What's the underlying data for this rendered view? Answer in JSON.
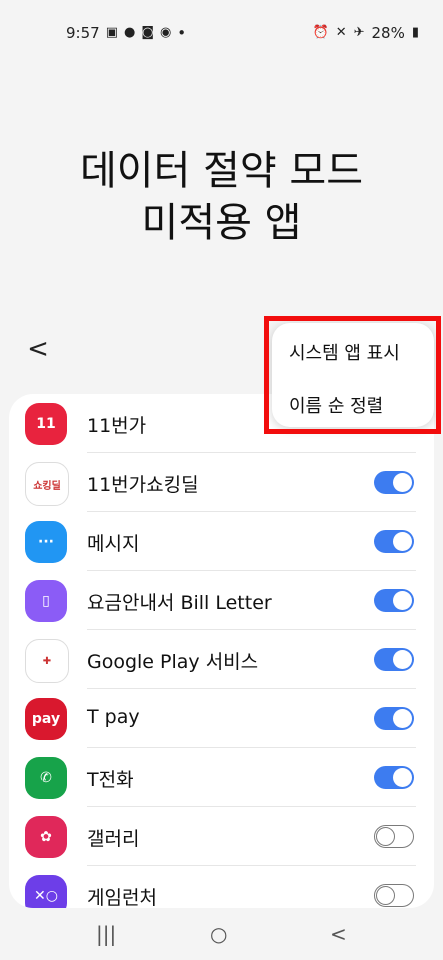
{
  "status_bar": {
    "time": "9:57",
    "left_icons": [
      "gallery-icon",
      "talk-icon",
      "tv-icon",
      "location-icon"
    ],
    "dot": "•",
    "right_icons": [
      "alarm-icon",
      "mute-icon",
      "airplane-icon"
    ],
    "battery": "28%"
  },
  "page": {
    "title_line1": "데이터 절약 모드",
    "title_line2": "미적용 앱"
  },
  "header": {
    "back_label": "<"
  },
  "apps": [
    {
      "name": "11번가",
      "icon": "11st-icon",
      "icon_text": "11",
      "icon_color": "#e8233e",
      "toggle": null
    },
    {
      "name": "11번가쇼킹딜",
      "icon": "shocking-deal-icon",
      "icon_text": "쇼킹딜",
      "icon_color": "#ffffff",
      "toggle": true
    },
    {
      "name": "메시지",
      "icon": "message-icon",
      "icon_text": "···",
      "icon_color": "#2196f3",
      "toggle": true
    },
    {
      "name": "요금안내서 Bill Letter",
      "icon": "bill-letter-icon",
      "icon_text": "▯",
      "icon_color": "#8b5cf6",
      "toggle": true
    },
    {
      "name": "Google Play 서비스",
      "icon": "google-play-services-icon",
      "icon_text": "✚",
      "icon_color": "#ffffff",
      "toggle": true
    },
    {
      "name": "T pay",
      "icon": "tpay-icon",
      "icon_text": "pay",
      "icon_color": "#d9182e",
      "toggle": true
    },
    {
      "name": "T전화",
      "icon": "tphone-icon",
      "icon_text": "✆",
      "icon_color": "#17a34a",
      "toggle": true
    },
    {
      "name": "갤러리",
      "icon": "gallery-app-icon",
      "icon_text": "✿",
      "icon_color": "#e0285a",
      "toggle": false
    },
    {
      "name": "게임런처",
      "icon": "game-launcher-icon",
      "icon_text": "✕○",
      "icon_color": "#6d3ee8",
      "toggle": false
    }
  ],
  "menu": {
    "show_system_apps": "시스템 앱 표시",
    "sort_by_name": "이름 순 정렬"
  },
  "nav": {
    "recent": "|||",
    "home": "○",
    "back": "<"
  },
  "colors": {
    "highlight": "#f20d0d",
    "toggle_on": "#3d7cf0"
  }
}
